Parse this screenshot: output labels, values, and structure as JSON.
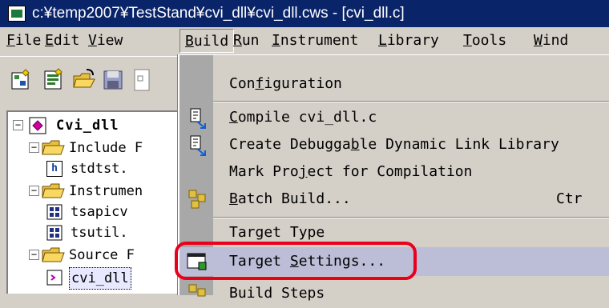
{
  "window": {
    "title": "c:¥temp2007¥TestStand¥cvi_dll¥cvi_dll.cws - [cvi_dll.c]"
  },
  "menubar": {
    "items": [
      {
        "label": "File",
        "mnemonic": "F",
        "rest": "ile"
      },
      {
        "label": "Edit",
        "mnemonic": "E",
        "rest": "dit"
      },
      {
        "label": "View",
        "mnemonic": "V",
        "rest": "iew"
      },
      {
        "label": "Build",
        "mnemonic": "B",
        "rest": "uild",
        "active": true
      },
      {
        "label": "Run",
        "mnemonic": "R",
        "rest": "un"
      },
      {
        "label": "Instrument",
        "mnemonic": "I",
        "rest": "nstrument"
      },
      {
        "label": "Library",
        "mnemonic": "L",
        "rest": "ibrary"
      },
      {
        "label": "Tools",
        "mnemonic": "T",
        "rest": "ools"
      },
      {
        "label": "Wind",
        "mnemonic": "W",
        "rest": "ind"
      }
    ]
  },
  "toolbar": {
    "icons": [
      "new-project-icon",
      "new-file-icon",
      "open-folder-icon",
      "save-icon",
      "toolbar-icon"
    ]
  },
  "tree": {
    "root": {
      "label": "Cvi_dll"
    },
    "rows": [
      {
        "label": "Include F",
        "kind": "folder"
      },
      {
        "label": "stdtst.",
        "kind": "header-file"
      },
      {
        "label": "Instrumen",
        "kind": "folder"
      },
      {
        "label": "tsapicv",
        "kind": "instrument-file"
      },
      {
        "label": "tsutil.",
        "kind": "instrument-file"
      },
      {
        "label": "Source F",
        "kind": "folder"
      },
      {
        "label": "cvi_dll",
        "kind": "source-file"
      }
    ]
  },
  "build_menu": {
    "items": [
      {
        "pre": "Con",
        "mnem": "f",
        "post": "iguration",
        "icon": ""
      },
      {
        "pre": "",
        "mnem": "C",
        "post": "ompile cvi_dll.c",
        "icon": "compile-icon"
      },
      {
        "pre": "Create Debugga",
        "mnem": "b",
        "post": "le Dynamic Link Library",
        "icon": "create-dll-icon"
      },
      {
        "pre": "Mark Pro",
        "mnem": "j",
        "post": "ect for Compilation",
        "icon": ""
      },
      {
        "pre": "",
        "mnem": "B",
        "post": "atch Build...",
        "icon": "batch-build-icon",
        "shortcut": "Ctr"
      },
      {
        "pre": "Target Type",
        "mnem": "",
        "post": "",
        "icon": ""
      },
      {
        "pre": "Target ",
        "mnem": "S",
        "post": "ettings...",
        "icon": "target-settings-icon",
        "highlighted": true
      },
      {
        "pre": "Build Steps",
        "mnem": "",
        "post": "",
        "icon": "build-steps-icon"
      }
    ]
  },
  "colors": {
    "titlebar": "#0a246a",
    "highlight": "#bcbed8",
    "callout": "#e8001c"
  }
}
